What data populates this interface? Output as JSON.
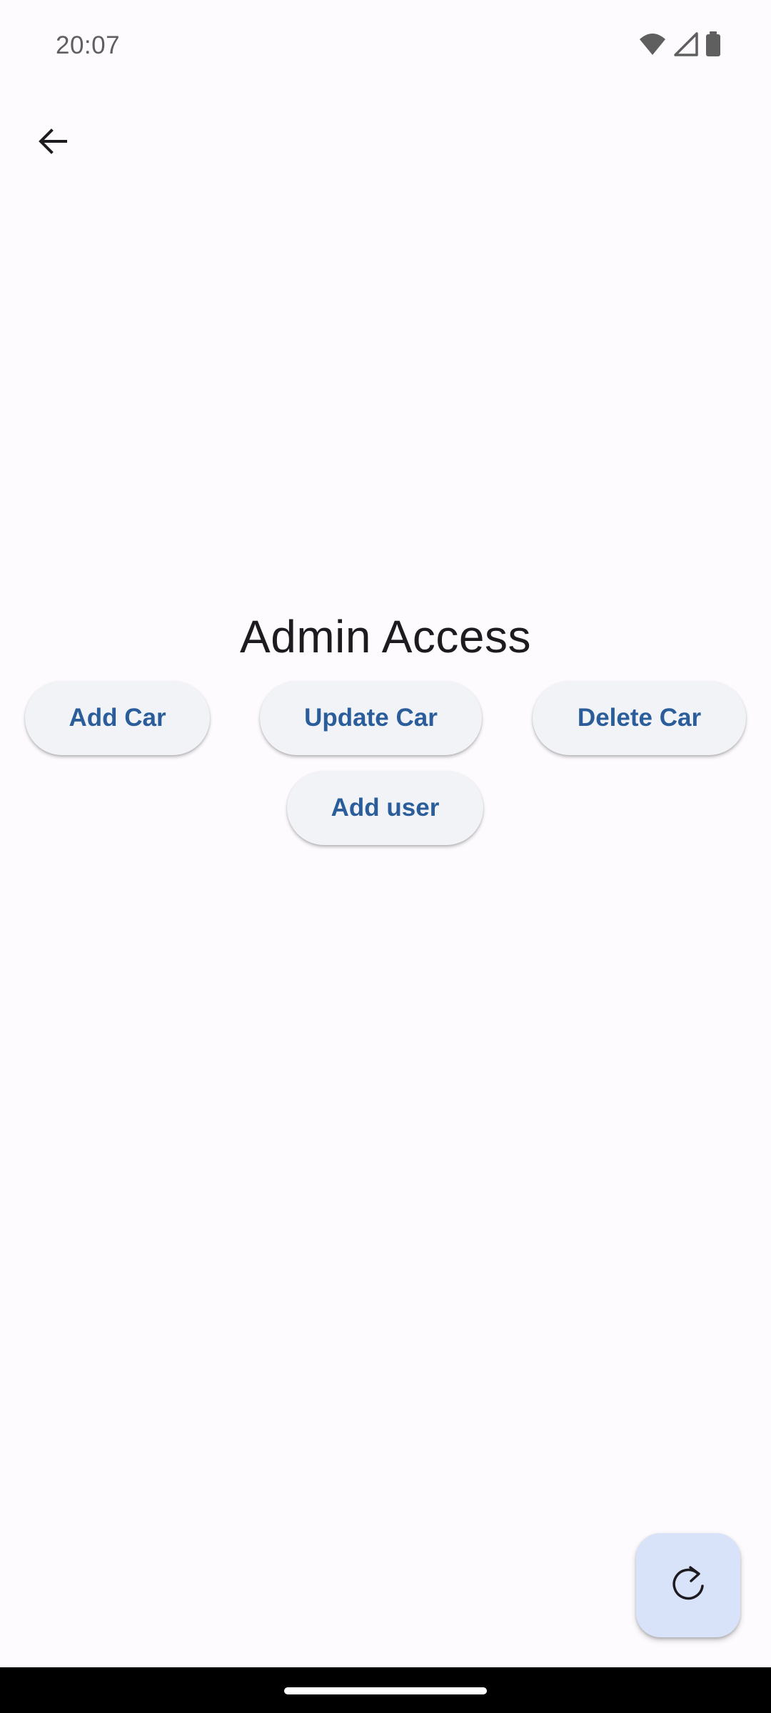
{
  "status_bar": {
    "time": "20:07",
    "icons": [
      "wifi-icon",
      "signal-icon",
      "battery-icon"
    ]
  },
  "app_bar": {
    "back_icon": "arrow-back-icon"
  },
  "main": {
    "title": "Admin Access",
    "buttons": {
      "add_car": "Add Car",
      "update_car": "Update Car",
      "delete_car": "Delete Car",
      "add_user": "Add user"
    }
  },
  "fab": {
    "icon": "refresh-icon"
  },
  "colors": {
    "background": "#fdfbfd",
    "button_bg": "#f1f3f7",
    "button_text": "#2a5d9a",
    "fab_bg": "#d8e2f9",
    "title_text": "#1d1b20"
  }
}
